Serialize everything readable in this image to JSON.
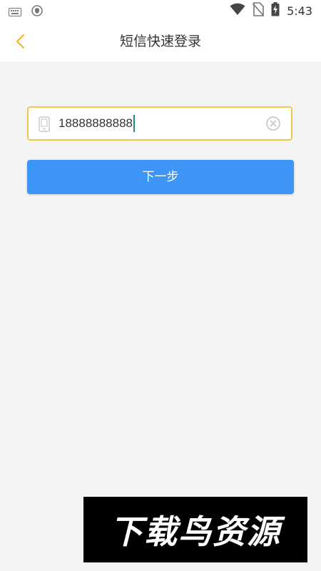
{
  "status_bar": {
    "time": "5:43",
    "icons": [
      "keyboard-icon",
      "shield-icon",
      "wifi-icon",
      "no-sim-icon",
      "battery-charging-icon"
    ]
  },
  "header": {
    "back_icon": "chevron-left-icon",
    "title": "短信快速登录"
  },
  "form": {
    "phone_icon": "phone-icon",
    "phone_value": "18888888888",
    "clear_icon": "clear-circle-icon",
    "next_label": "下一步"
  },
  "watermark": {
    "text": "下载鸟资源"
  },
  "colors": {
    "accent": "#f2c84a",
    "primary_button": "#3d96f5",
    "background": "#f4f4f4"
  }
}
